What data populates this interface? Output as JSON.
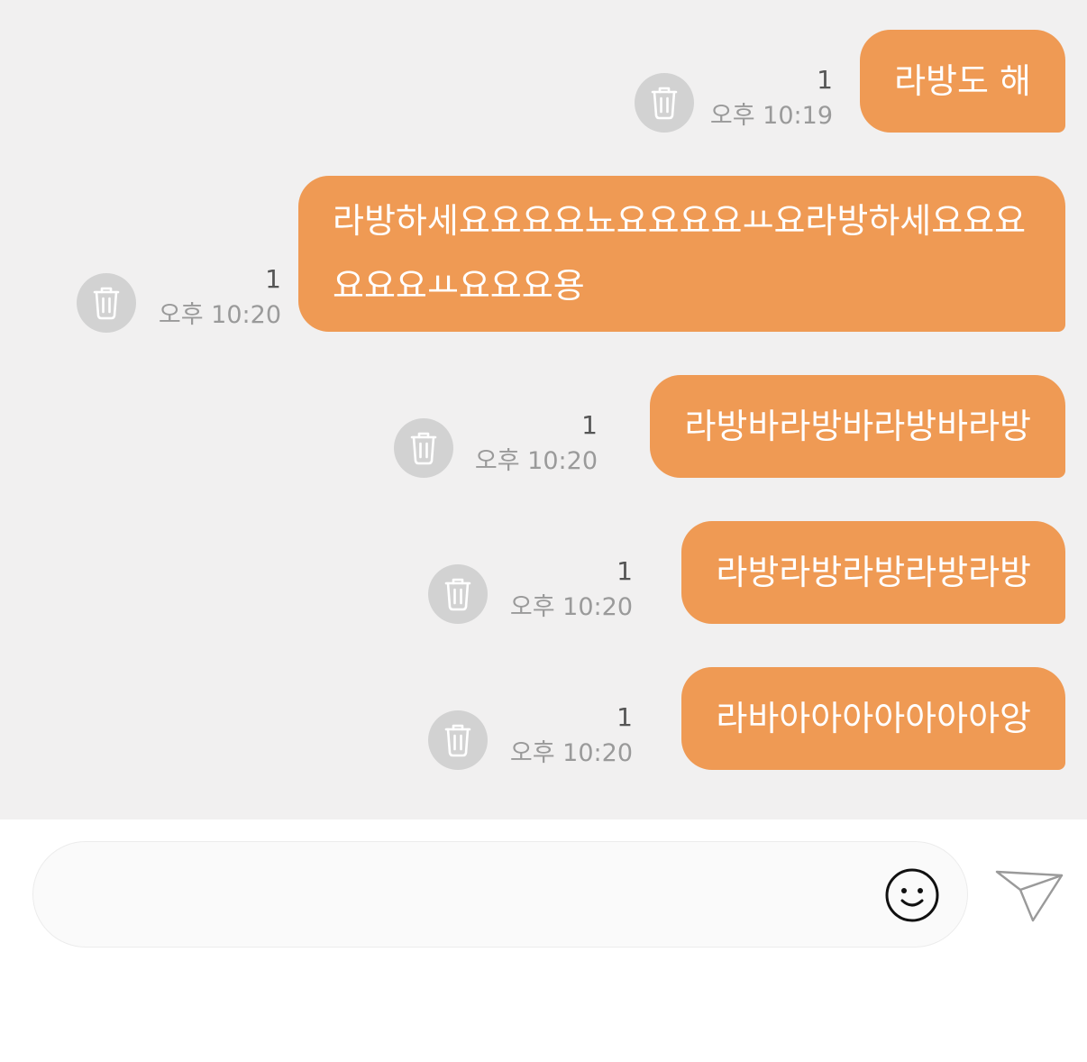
{
  "messages": [
    {
      "text": "라방도 해",
      "read_count": "1",
      "time": "오후 10:19",
      "delete_icon": "trash-icon"
    },
    {
      "text": "라방하세요요요요뇨요요요요ㅛ요라방하세요요요요요요ㅛ요요요용",
      "read_count": "1",
      "time": "오후 10:20",
      "delete_icon": "trash-icon"
    },
    {
      "text": "라방바라방바라방바라방",
      "read_count": "1",
      "time": "오후 10:20",
      "delete_icon": "trash-icon"
    },
    {
      "text": "라방라방라방라방라방",
      "read_count": "1",
      "time": "오후 10:20",
      "delete_icon": "trash-icon"
    },
    {
      "text": "라바아아아아아아아앙",
      "read_count": "1",
      "time": "오후 10:20",
      "delete_icon": "trash-icon"
    }
  ],
  "composer": {
    "value": "",
    "placeholder": "",
    "emoji_icon": "smiley-icon",
    "send_icon": "paper-plane-icon"
  },
  "colors": {
    "bubble": "#ef9a54",
    "chat_background": "#f1f0f0",
    "trash_circle": "#d2d2d2"
  }
}
